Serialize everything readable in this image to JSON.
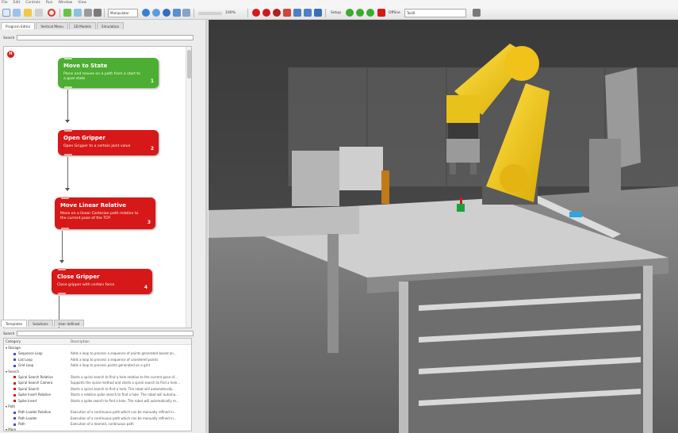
{
  "menu": [
    "File",
    "Edit",
    "Controls",
    "Run",
    "Window",
    "View"
  ],
  "toolbar": {
    "manipulator_label": "Manipulator",
    "speed_label": "100%",
    "setup_label": "Setup",
    "offline_label": "Offline",
    "tool_label": "Tool0",
    "accent_red": "#d71818",
    "accent_green": "#4cae32"
  },
  "left_tabs": [
    "Program Editor",
    "Vertical Menu",
    "3D Models",
    "Simulation"
  ],
  "search": {
    "label": "Search",
    "placeholder": ""
  },
  "nodes": [
    {
      "title": "Move to State",
      "desc": "Plans and moves on a path from a start to a goal state",
      "num": "1",
      "color": "green"
    },
    {
      "title": "Open Gripper",
      "desc": "Open Gripper to a certain joint value",
      "num": "2",
      "color": "red"
    },
    {
      "title": "Move Linear Relative",
      "desc": "Move on a linear Cartesian path relative to the current pose of the TCP",
      "num": "3",
      "color": "red"
    },
    {
      "title": "Close Gripper",
      "desc": "Close gripper with certain force",
      "num": "4",
      "color": "red"
    }
  ],
  "bottom_tabs": [
    "Templates",
    "Solutions",
    "User defined"
  ],
  "bottom_search_label": "Search",
  "tree_columns": [
    "Category",
    "Description"
  ],
  "tree": [
    {
      "level": 1,
      "label": "Storage",
      "desc": ""
    },
    {
      "level": 2,
      "label": "Sequence Loop",
      "desc": "Adds a loop to process a sequence of points generated based on...",
      "color": "#4b4bc9"
    },
    {
      "level": 2,
      "label": "List Loop",
      "desc": "Adds a loop to process a sequence of unordered points",
      "color": "#4b4bc9"
    },
    {
      "level": 2,
      "label": "Grid Loop",
      "desc": "Adds a loop to process points generated on a grid",
      "color": "#4b4bc9"
    },
    {
      "level": 1,
      "label": "Search",
      "desc": ""
    },
    {
      "level": 2,
      "label": "Spiral Search Relative",
      "desc": "Starts a spiral search to find a hole relative to the current pose of...",
      "color": "#d71818"
    },
    {
      "level": 2,
      "label": "Spiral Search Camera",
      "desc": "Supports the spiral method and starts a spiral search to find a hole...",
      "color": "#d71818"
    },
    {
      "level": 2,
      "label": "Spiral Search",
      "desc": "Starts a spiral search to find a hole. The robot will automatically...",
      "color": "#d71818"
    },
    {
      "level": 2,
      "label": "Spike Insert Relative",
      "desc": "Starts a relative spike search to find a hole. The robot will automa...",
      "color": "#d71818"
    },
    {
      "level": 2,
      "label": "Spike Insert",
      "desc": "Starts a spike search to find a hole. The robot will automatically m...",
      "color": "#d71818"
    },
    {
      "level": 1,
      "label": "Path",
      "desc": ""
    },
    {
      "level": 2,
      "label": "Path Loader Relative",
      "desc": "Execution of a continuous path which can be manually refined in...",
      "color": "#4b4bc9"
    },
    {
      "level": 2,
      "label": "Path Loader",
      "desc": "Execution of a continuous path which can be manually refined in...",
      "color": "#4b4bc9"
    },
    {
      "level": 2,
      "label": "Path",
      "desc": "Execution of a learned, continuous path",
      "color": "#4b4bc9"
    },
    {
      "level": 1,
      "label": "More",
      "desc": ""
    }
  ]
}
